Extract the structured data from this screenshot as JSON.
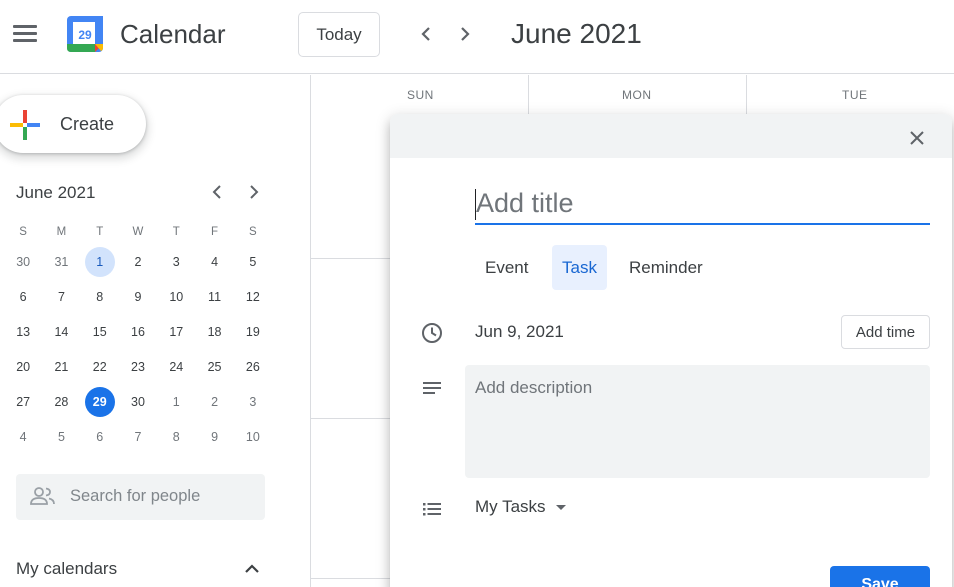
{
  "header": {
    "app_title": "Calendar",
    "logo_day": "29",
    "today_label": "Today",
    "month_title": "June 2021"
  },
  "sidebar": {
    "create_label": "Create",
    "mini_calendar": {
      "title": "June 2021",
      "weekdays": [
        "S",
        "M",
        "T",
        "W",
        "T",
        "F",
        "S"
      ],
      "weeks": [
        [
          "30",
          "31",
          "1",
          "2",
          "3",
          "4",
          "5"
        ],
        [
          "6",
          "7",
          "8",
          "9",
          "10",
          "11",
          "12"
        ],
        [
          "13",
          "14",
          "15",
          "16",
          "17",
          "18",
          "19"
        ],
        [
          "20",
          "21",
          "22",
          "23",
          "24",
          "25",
          "26"
        ],
        [
          "27",
          "28",
          "29",
          "30",
          "1",
          "2",
          "3"
        ],
        [
          "4",
          "5",
          "6",
          "7",
          "8",
          "9",
          "10"
        ]
      ],
      "selected_day": "1",
      "today": "29"
    },
    "search_people_placeholder": "Search for people",
    "my_calendars_label": "My calendars"
  },
  "main": {
    "day_headers": [
      "SUN",
      "MON",
      "TUE"
    ]
  },
  "dialog": {
    "title_placeholder": "Add title",
    "types": [
      "Event",
      "Task",
      "Reminder"
    ],
    "active_type": "Task",
    "date": "Jun 9, 2021",
    "add_time_label": "Add time",
    "description_placeholder": "Add description",
    "task_list": "My Tasks",
    "save_label": "Save"
  },
  "colors": {
    "accent": "#1a73e8",
    "active_tab_bg": "#e8f0fe",
    "selected_day_bg": "#d2e3fc"
  }
}
